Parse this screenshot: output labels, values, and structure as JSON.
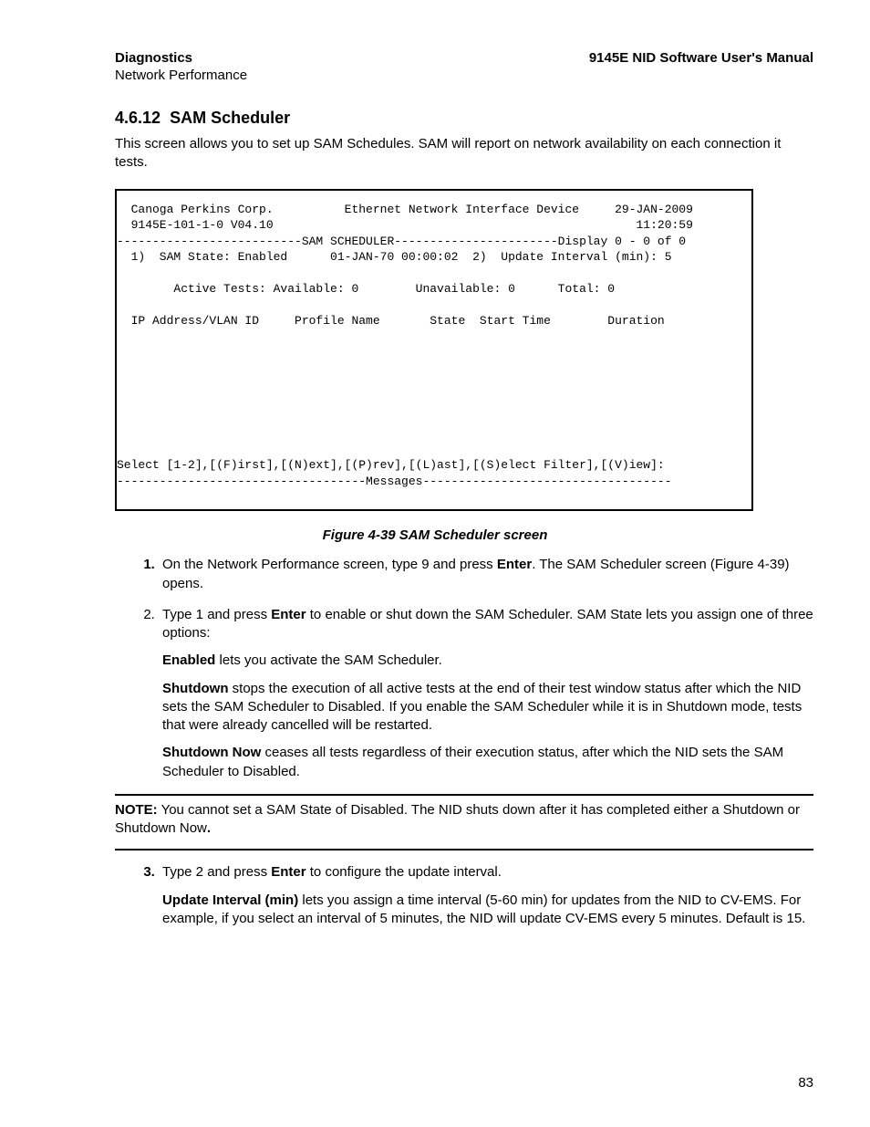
{
  "header": {
    "left": "Diagnostics",
    "right": "9145E NID Software User's Manual",
    "sub": "Network Performance"
  },
  "section": {
    "number": "4.6.12",
    "title": "SAM Scheduler",
    "intro": "This screen allows you to set up SAM Schedules. SAM will report on network availability on each connection it tests."
  },
  "terminal": {
    "l1": "  Canoga Perkins Corp.          Ethernet Network Interface Device     29-JAN-2009",
    "l2": "  9145E-101-1-0 V04.10                                                   11:20:59",
    "l3": "--------------------------SAM SCHEDULER-----------------------Display 0 - 0 of 0",
    "l4": "  1)  SAM State: Enabled      01-JAN-70 00:00:02  2)  Update Interval (min): 5",
    "l5": "",
    "l6": "        Active Tests: Available: 0        Unavailable: 0      Total: 0",
    "l7": "",
    "l8": "  IP Address/VLAN ID     Profile Name       State  Start Time        Duration",
    "l9": "",
    "l10": "",
    "l11": "",
    "l12": "",
    "l13": "",
    "l14": "",
    "l15": "",
    "l16": "",
    "l17": "Select [1-2],[(F)irst],[(N)ext],[(P)rev],[(L)ast],[(S)elect Filter],[(V)iew]:",
    "l18": "-----------------------------------Messages-----------------------------------"
  },
  "figure_caption": "Figure 4-39  SAM Scheduler screen",
  "steps": {
    "s1a": "On the Network Performance screen, type 9 and press ",
    "s1b": "Enter",
    "s1c": ". The SAM Scheduler screen (Figure 4-39) opens.",
    "s2a": "Type 1 and press ",
    "s2b": "Enter",
    "s2c": " to enable or shut down the SAM Scheduler. SAM State lets you assign one of three options:",
    "s2_en_b": "Enabled",
    "s2_en_t": " lets you activate the SAM Scheduler.",
    "s2_sd_b": "Shutdown",
    "s2_sd_t": " stops the execution of all active tests at the end of their test window status after which the NID sets the SAM Scheduler to Disabled. If you enable the SAM Scheduler while it is in  Shutdown mode, tests that were already cancelled will be restarted.",
    "s2_sn_b": "Shutdown Now",
    "s2_sn_t": " ceases all tests regardless of their execution status, after which the NID sets the SAM Scheduler to Disabled.",
    "s3a": "Type 2 and press ",
    "s3b": "Enter",
    "s3c": " to configure the update interval.",
    "s3_ui_b": "Update Interval (min)",
    "s3_ui_t": " lets you assign a time interval (5-60 min) for updates from the NID to CV-EMS. For example, if you select an interval of 5 minutes, the NID will update CV-EMS every 5 minutes. Default is 15."
  },
  "note": {
    "label": "NOTE:",
    "text": " You cannot set a SAM State of Disabled. The NID shuts down after it has completed either a Shutdown or Shutdown Now",
    "period": "."
  },
  "page_number": "83"
}
